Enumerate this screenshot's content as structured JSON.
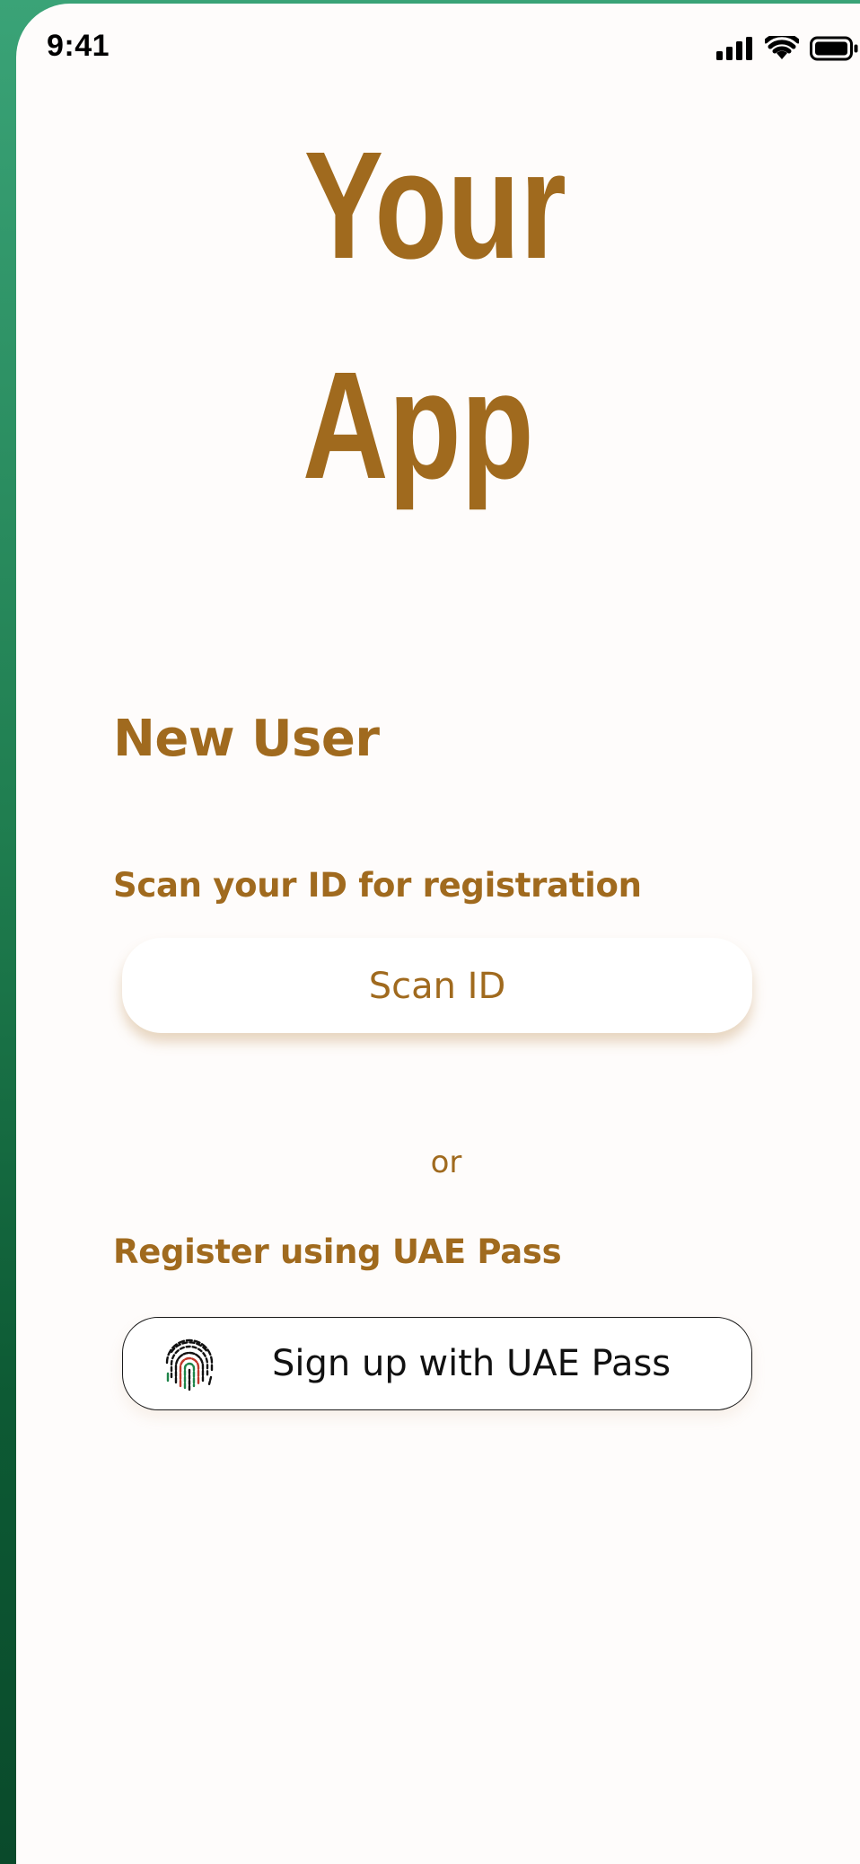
{
  "status_bar": {
    "time": "9:41"
  },
  "app": {
    "title_line1": "Your",
    "title_line2": "App"
  },
  "new_user": {
    "heading": "New User",
    "scan_label": "Scan your ID for registration",
    "scan_button_label": "Scan ID",
    "or_label": "or",
    "uae_label": "Register using UAE Pass",
    "uae_button_label": "Sign up with UAE Pass",
    "uae_button_icon": "fingerprint-icon"
  },
  "colors": {
    "brand": "#a06a1e",
    "background": "#fefcfb",
    "backdrop_green": "#1f7d4f",
    "uae_red": "#c0392b",
    "uae_green": "#1e8449"
  }
}
